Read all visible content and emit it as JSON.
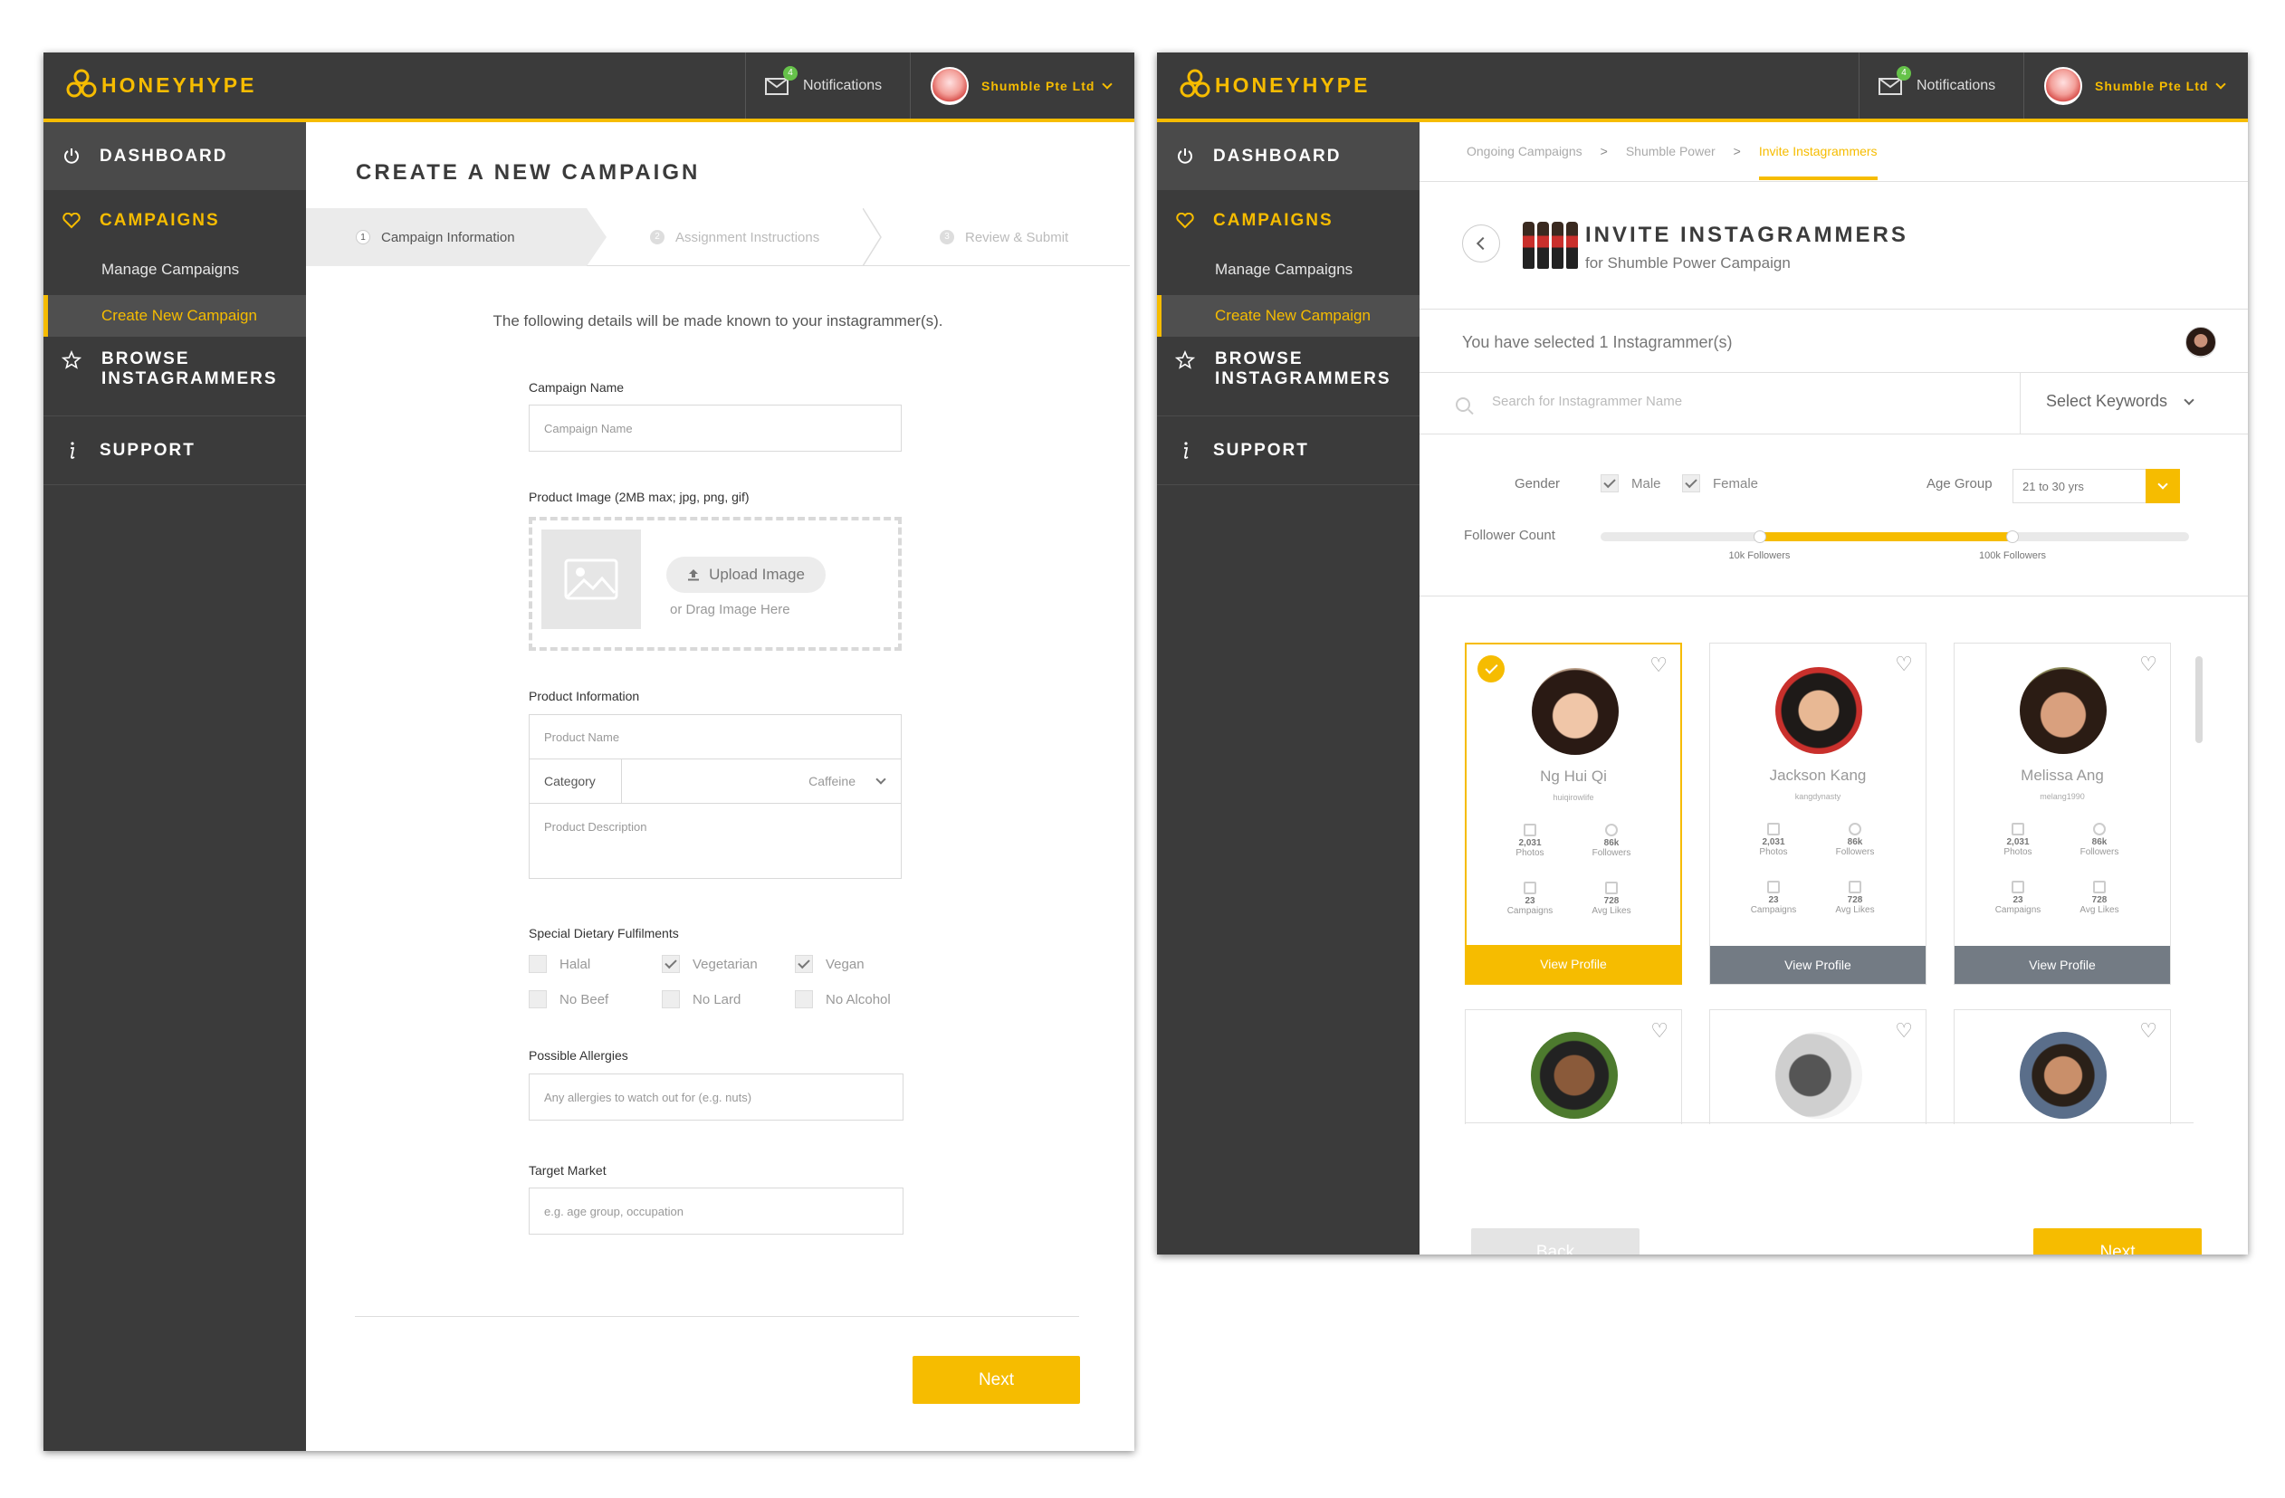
{
  "brand": {
    "name": "HONEYHYPE"
  },
  "header": {
    "notifications_label": "Notifications",
    "notifications_count": "4",
    "account_name": "Shumble Pte Ltd"
  },
  "sidebar": {
    "dashboard": "DASHBOARD",
    "campaigns": "CAMPAIGNS",
    "manage_campaigns": "Manage Campaigns",
    "create_campaign": "Create New Campaign",
    "browse_line1": "BROWSE",
    "browse_line2": "INSTAGRAMMERS",
    "support": "SUPPORT"
  },
  "create": {
    "title": "CREATE A NEW CAMPAIGN",
    "steps": [
      {
        "num": "1",
        "label": "Campaign Information"
      },
      {
        "num": "2",
        "label": "Assignment Instructions"
      },
      {
        "num": "3",
        "label": "Review & Submit"
      }
    ],
    "intro": "The following details will be made known to your instagrammer(s).",
    "campaign_name_label": "Campaign Name",
    "campaign_name_placeholder": "Campaign Name",
    "product_image_label": "Product Image  (2MB max; jpg, png, gif)",
    "upload_button": "Upload Image",
    "upload_or": "or Drag Image Here",
    "product_info_label": "Product Information",
    "product_name_placeholder": "Product Name",
    "category_label": "Category",
    "category_value": "Caffeine",
    "product_desc_placeholder": "Product Description",
    "dietary_label": "Special Dietary Fulfilments",
    "dietary": [
      {
        "label": "Halal",
        "checked": false
      },
      {
        "label": "Vegetarian",
        "checked": true
      },
      {
        "label": "Vegan",
        "checked": true
      },
      {
        "label": "No Beef",
        "checked": false
      },
      {
        "label": "No Lard",
        "checked": false
      },
      {
        "label": "No Alcohol",
        "checked": false
      }
    ],
    "allergies_label": "Possible Allergies",
    "allergies_placeholder": "Any allergies to watch out for (e.g. nuts)",
    "target_label": "Target Market",
    "target_placeholder": "e.g. age group, occupation",
    "next": "Next"
  },
  "invite": {
    "breadcrumb": [
      "Ongoing Campaigns",
      "Shumble Power",
      "Invite Instagrammers"
    ],
    "breadcrumb_sep": ">",
    "title": "INVITE INSTAGRAMMERS",
    "subtitle": "for Shumble Power Campaign",
    "selected_text": "You have selected 1 Instagrammer(s)",
    "search_placeholder": "Search for Instagrammer Name",
    "keywords_label": "Select Keywords",
    "gender_label": "Gender",
    "male": "Male",
    "female": "Female",
    "age_label": "Age Group",
    "age_value": "21 to 30 yrs",
    "follower_label": "Follower Count",
    "slider_min_label": "10k Followers",
    "slider_max_label": "100k Followers",
    "slider_range": {
      "low": 0.27,
      "high": 0.7
    },
    "cards": [
      {
        "name": "Ng Hui Qi",
        "handle": "huiqirowlife",
        "photos": "2,031",
        "followers": "86k",
        "campaigns": "23",
        "avg_likes": "728",
        "selected": true
      },
      {
        "name": "Jackson Kang",
        "handle": "kangdynasty",
        "photos": "2,031",
        "followers": "86k",
        "campaigns": "23",
        "avg_likes": "728",
        "selected": false
      },
      {
        "name": "Melissa Ang",
        "handle": "melang1990",
        "photos": "2,031",
        "followers": "86k",
        "campaigns": "23",
        "avg_likes": "728",
        "selected": false
      }
    ],
    "stat_labels": {
      "photos": "Photos",
      "followers": "Followers",
      "campaigns": "Campaigns",
      "avg_likes": "Avg Likes"
    },
    "view_profile": "View Profile",
    "back": "Back",
    "next": "Next"
  },
  "colors": {
    "accent": "#f6bc00",
    "sidebar": "#3b3b3b",
    "card_button": "#737b84"
  }
}
